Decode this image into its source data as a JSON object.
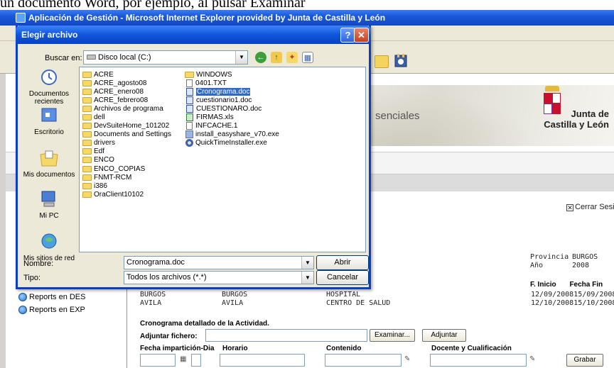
{
  "caption": "un documento Word, por ejemplo, al pulsar Examinar",
  "ie": {
    "title": "Aplicación de Gestión - Microsoft Internet Explorer provided by Junta de Castilla y León",
    "banner_text": "senciales",
    "logo": {
      "line1": "Junta de",
      "line2": "Castilla y León"
    },
    "cerrar": "Cerrar Sesion",
    "info": {
      "provincia_label": "Provincia",
      "provincia_value": "BURGOS",
      "anio_label": "Año",
      "anio_value": "2008",
      "finicio_label": "F. Inicio",
      "ffin_label": "Fecha Fin"
    },
    "left_links": [
      "Reports en DES",
      "Reports en EXP"
    ],
    "rows": [
      {
        "c1": "BURGOS",
        "c2": "BURGOS",
        "c3": "HOSPITAL",
        "c4": "12/09/200815/09/2008"
      },
      {
        "c1": "AVILA",
        "c2": "AVILA",
        "c3": "CENTRO DE SALUD",
        "c4": "12/10/200815/10/2008"
      }
    ],
    "crono_title": "Cronograma detallado de la Actividad.",
    "adjuntar_label": "Adjuntar fichero:",
    "examinar": "Examinar...",
    "adjuntar_btn": "Adjuntar",
    "cols": {
      "fecha": "Fecha impartición-Dia",
      "horario": "Horario",
      "contenido": "Contenido",
      "docente": "Docente y Cualificación"
    },
    "grabar": "Grabar"
  },
  "dialog": {
    "title": "Elegir archivo",
    "buscar_label": "Buscar en:",
    "location": "Disco local (C:)",
    "places": [
      "Documentos recientes",
      "Escritorio",
      "Mis documentos",
      "Mi PC",
      "Mis sitios de red"
    ],
    "col1": [
      "ACRE",
      "ACRE_agosto08",
      "ACRE_enero08",
      "ACRE_febrero08",
      "Archivos de programa",
      "dell",
      "DevSuiteHome_101202",
      "Documents and Settings",
      "drivers",
      "Edf",
      "ENCO",
      "ENCO_COPIAS",
      "FNMT-RCM",
      "i386",
      "OraClient10102"
    ],
    "col2": [
      "WINDOWS",
      "0401.TXT",
      "Cronograma.doc",
      "cuestionario1.doc",
      "CUESTIONARO.doc",
      "FIRMAS.xls",
      "INFCACHE.1",
      "install_easyshare_v70.exe",
      "QuickTimeInstaller.exe"
    ],
    "nombre_label": "Nombre:",
    "nombre_value": "Cronograma.doc",
    "tipo_label": "Tipo:",
    "tipo_value": "Todos los archivos (*.*)",
    "abrir": "Abrir",
    "cancelar": "Cancelar",
    "help_glyph": "?",
    "close_glyph": "✕"
  }
}
